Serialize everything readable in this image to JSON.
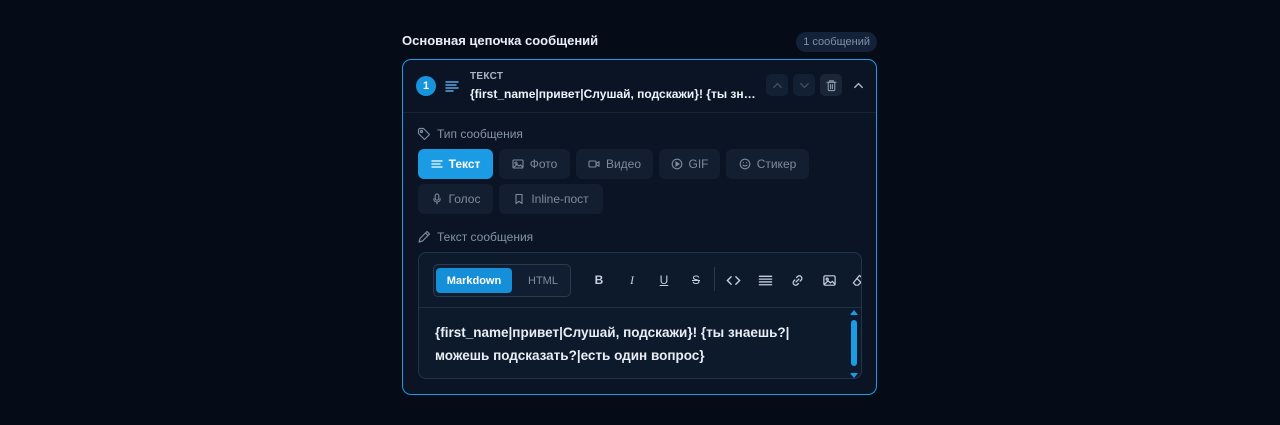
{
  "chain": {
    "title": "Основная цепочка сообщений",
    "count_badge": "1 сообщений"
  },
  "message": {
    "number": "1",
    "type_label": "ТЕКСТ",
    "preview": "{first_name|привет|Слушай, подскажи}! {ты зна...",
    "icons": {
      "type": "text-lines-icon",
      "move_up": "chevron-up-icon",
      "move_down": "chevron-down-icon",
      "delete": "trash-icon",
      "collapse": "chevron-up-icon"
    }
  },
  "type_section": {
    "label": "Тип сообщения",
    "icon": "tag-icon",
    "types": [
      {
        "label": "Текст",
        "icon": "text-lines-icon",
        "active": true
      },
      {
        "label": "Фото",
        "icon": "image-icon",
        "active": false
      },
      {
        "label": "Видео",
        "icon": "video-icon",
        "active": false
      },
      {
        "label": "GIF",
        "icon": "play-circle-icon",
        "active": false
      },
      {
        "label": "Стикер",
        "icon": "smile-icon",
        "active": false
      },
      {
        "label": "Голос",
        "icon": "microphone-icon",
        "active": false
      },
      {
        "label": "Inline-пост",
        "icon": "bookmark-icon",
        "active": false
      }
    ]
  },
  "text_section": {
    "label": "Текст сообщения",
    "icon": "pencil-icon"
  },
  "editor": {
    "modes": {
      "markdown": "Markdown",
      "html": "HTML",
      "selected": "Markdown"
    },
    "tools": {
      "bold": "B",
      "italic": "I",
      "underline": "U",
      "strike": "S",
      "code": "code-icon",
      "align": "align-lines-icon",
      "link": "link-icon",
      "image": "image-icon",
      "clear": "eraser-icon"
    },
    "content_line1": "{first_name|привет|Слушай, подскажи}! {ты знаешь?|",
    "content_line2": "можешь подсказать?|есть один вопрос}"
  },
  "colors": {
    "accent": "#1a9be3",
    "background": "#050c17",
    "card": "#0a1424"
  }
}
